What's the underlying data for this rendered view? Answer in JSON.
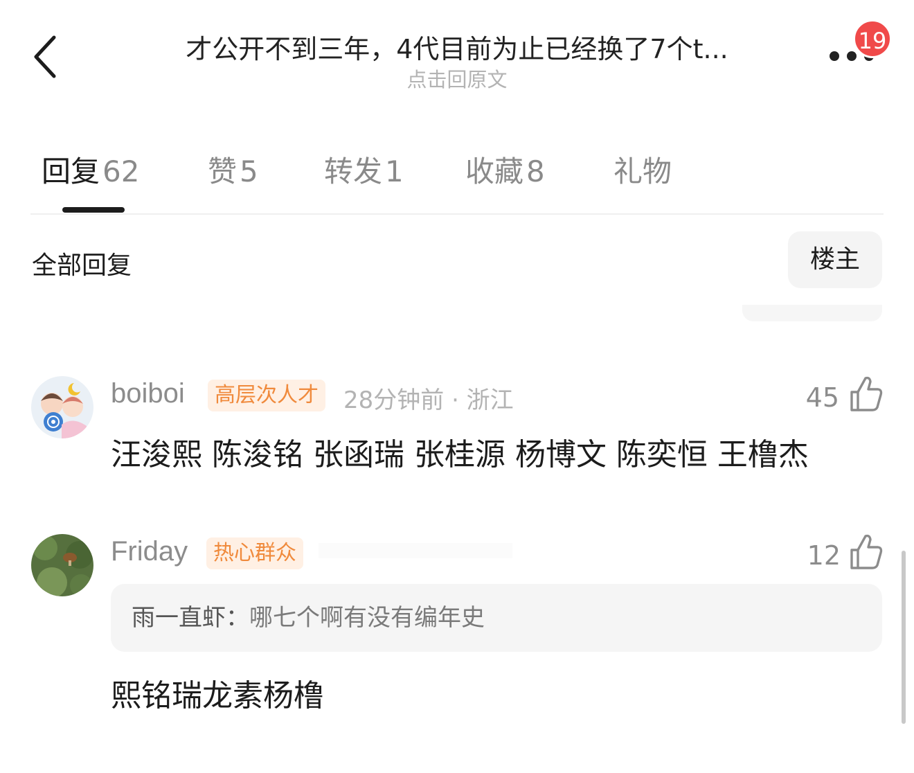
{
  "header": {
    "title": "才公开不到三年，4代目前为止已经换了7个t...",
    "subtitle": "点击回原文",
    "badge_count": "19"
  },
  "tabs": [
    {
      "label": "回复",
      "count": "62",
      "active": true
    },
    {
      "label": "赞",
      "count": "5",
      "active": false
    },
    {
      "label": "转发",
      "count": "1",
      "active": false
    },
    {
      "label": "收藏",
      "count": "8",
      "active": false
    },
    {
      "label": "礼物",
      "count": "",
      "active": false
    }
  ],
  "filter": {
    "label": "全部回复",
    "button": "楼主"
  },
  "comments": [
    {
      "username": "boiboi",
      "tag": "高层次人才",
      "meta": "28分钟前 · 浙江",
      "likes": "45",
      "text": "汪浚熙 陈浚铭 张函瑞 张桂源 杨博文 陈奕恒 王橹杰"
    },
    {
      "username": "Friday",
      "tag": "热心群众",
      "likes": "12",
      "quote_name": "雨一直虾：",
      "quote_text": "哪七个啊有没有编年史",
      "text": "熙铭瑞龙素杨橹"
    }
  ],
  "colors": {
    "tag_bg": "#fff0e4",
    "tag_text": "#f08a3c",
    "badge": "#f04a4a"
  }
}
